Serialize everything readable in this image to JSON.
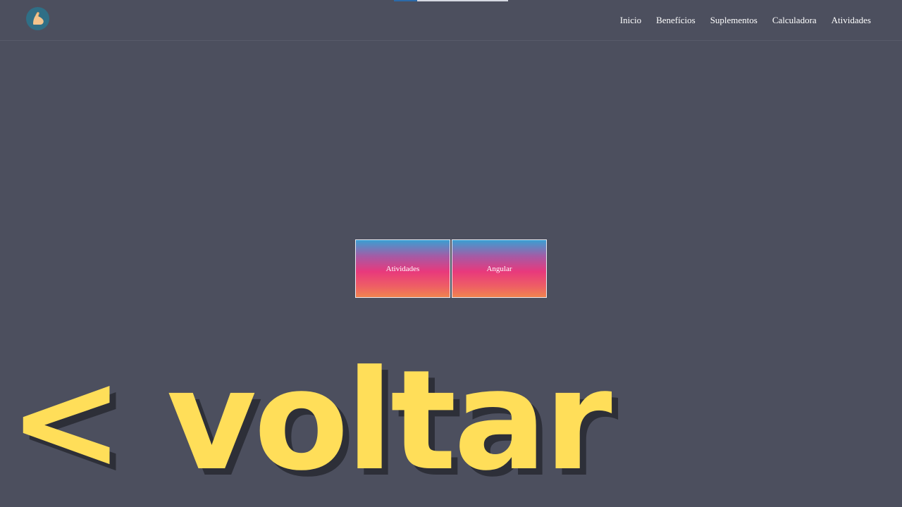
{
  "header": {
    "logo_icon": "flexed-arm-icon",
    "nav": [
      {
        "label": "Inicio"
      },
      {
        "label": "Benefícios"
      },
      {
        "label": "Suplementos"
      },
      {
        "label": "Calculadora"
      },
      {
        "label": "Atividades"
      }
    ]
  },
  "cards": [
    {
      "label": "Atividades"
    },
    {
      "label": "Angular"
    }
  ],
  "back_link": {
    "label": "< voltar"
  },
  "colors": {
    "background": "#4c4f5e",
    "accent_yellow": "#ffde59",
    "logo_circle": "#2f6f86",
    "card_gradient_top": "#3a9fd2",
    "card_gradient_mid": "#e8397c",
    "card_gradient_bottom": "#f0844f"
  }
}
